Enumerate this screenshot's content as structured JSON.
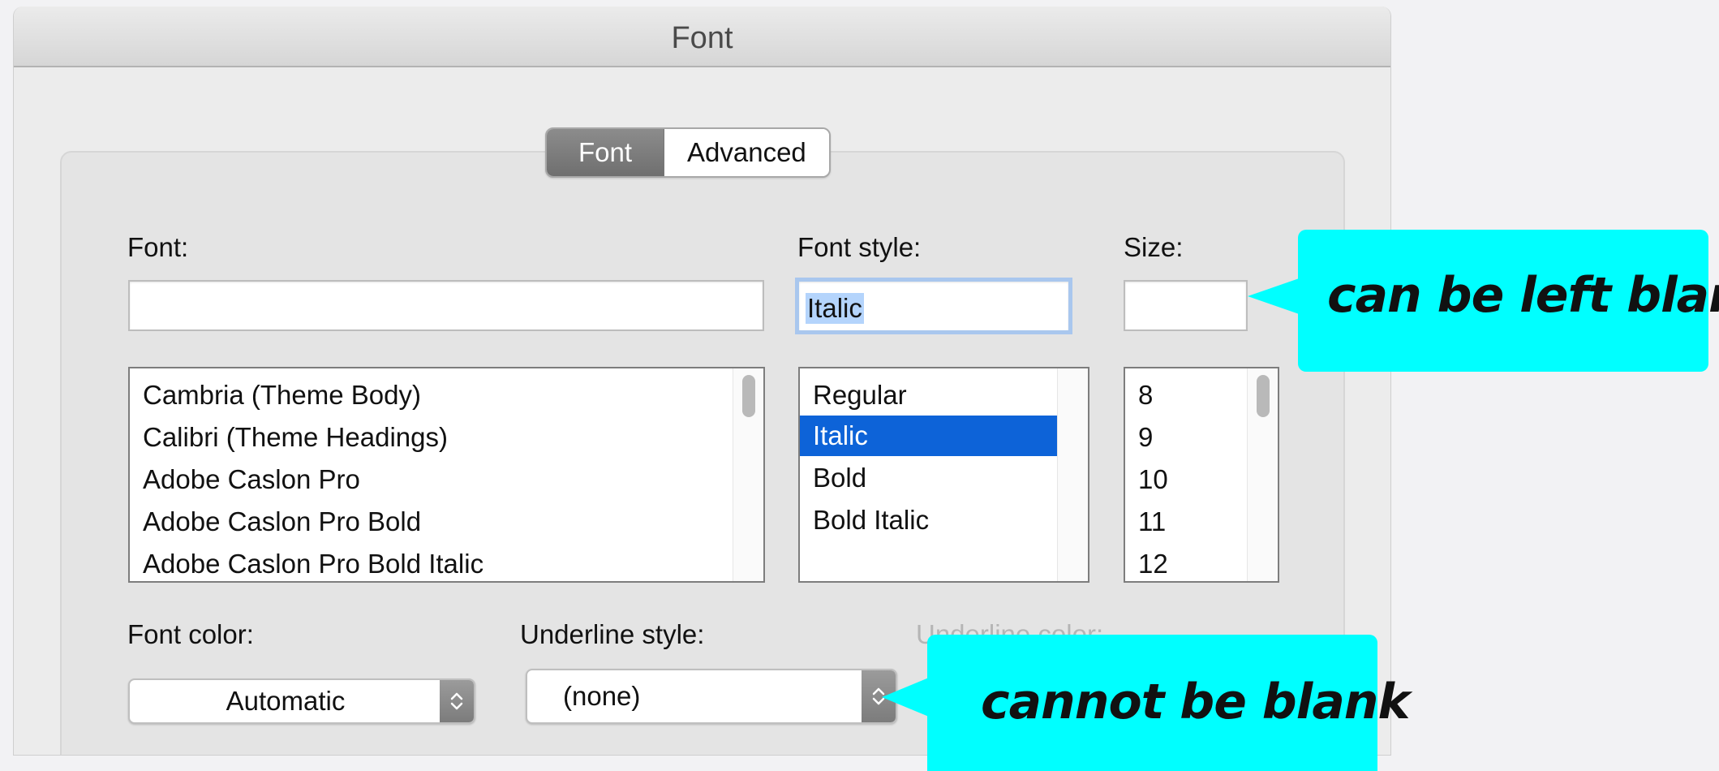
{
  "window": {
    "title": "Font"
  },
  "tabs": [
    {
      "label": "Font",
      "selected": true
    },
    {
      "label": "Advanced",
      "selected": false
    }
  ],
  "font": {
    "label": "Font:",
    "value": "",
    "options": [
      "Cambria (Theme Body)",
      "Calibri (Theme Headings)",
      "Adobe Caslon Pro",
      "Adobe Caslon Pro Bold",
      "Adobe Caslon Pro Bold Italic"
    ]
  },
  "font_style": {
    "label": "Font style:",
    "value": "Italic",
    "options": [
      "Regular",
      "Italic",
      "Bold",
      "Bold Italic"
    ],
    "selected": "Italic"
  },
  "size": {
    "label": "Size:",
    "value": "",
    "options": [
      "8",
      "9",
      "10",
      "11",
      "12"
    ]
  },
  "font_color": {
    "label": "Font color:",
    "value": "Automatic"
  },
  "underline_style": {
    "label": "Underline style:",
    "value": "(none)"
  },
  "underline_color": {
    "label": "Underline color:",
    "disabled": true
  },
  "annotations": {
    "top": "can be left blank",
    "bottom": "cannot be blank",
    "color": "#00ffff"
  },
  "icons": {
    "popup_stepper": "up-down-chevron-icon"
  }
}
